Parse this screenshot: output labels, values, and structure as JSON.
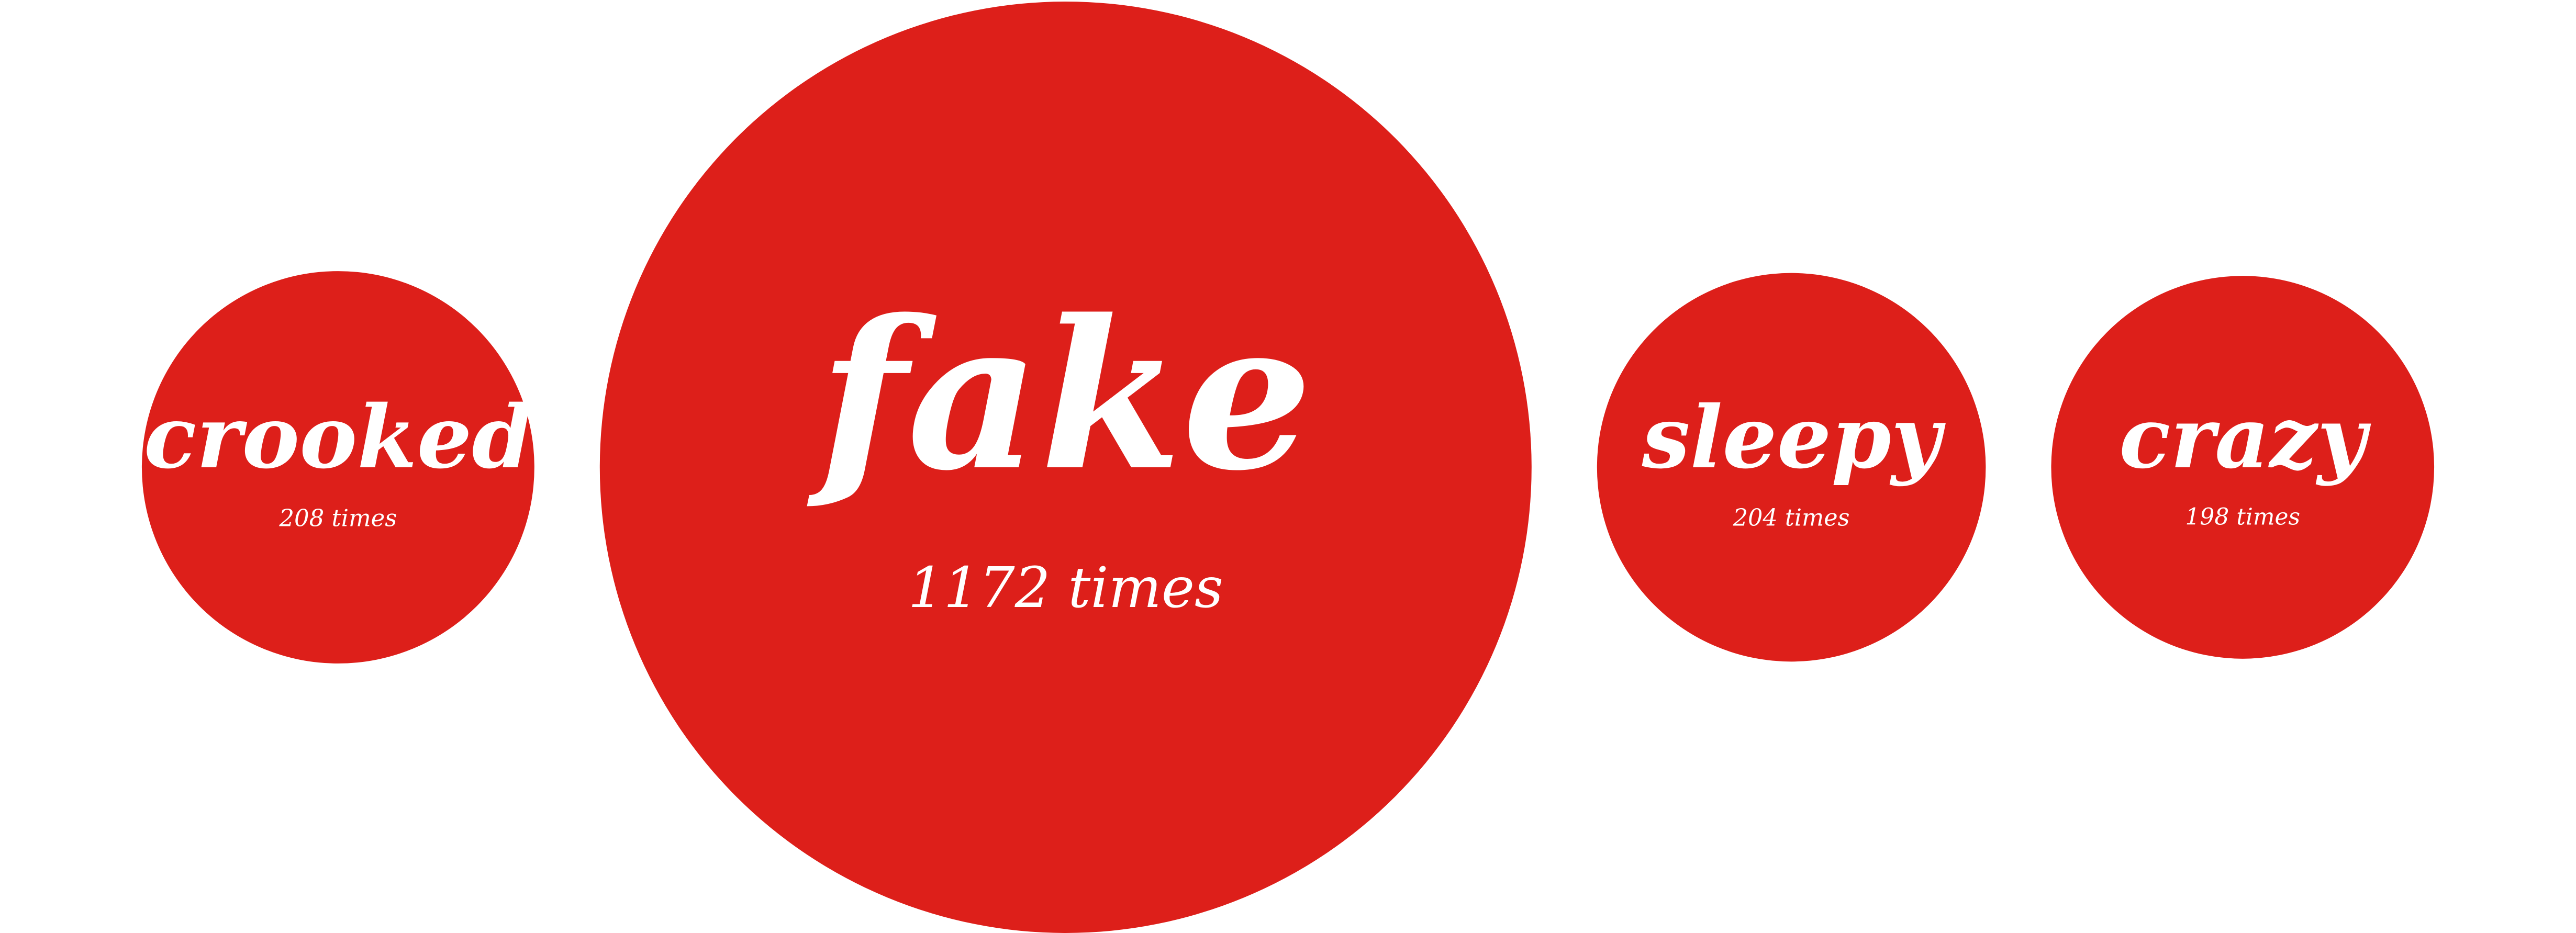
{
  "chart_data": {
    "type": "bubble",
    "title": "",
    "items": [
      {
        "word": "crooked",
        "count": 208,
        "label": "208 times"
      },
      {
        "word": "fake",
        "count": 1172,
        "label": "1172 times"
      },
      {
        "word": "sleepy",
        "count": 204,
        "label": "204 times"
      },
      {
        "word": "crazy",
        "count": 198,
        "label": "198 times"
      }
    ],
    "colors": {
      "bubble": "#dd1f1a",
      "text": "#ffffff",
      "background": "#ffffff"
    }
  }
}
